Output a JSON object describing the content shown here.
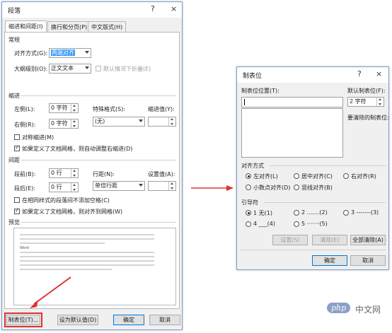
{
  "paragraph_dialog": {
    "title": "段落",
    "help_icon": "?",
    "close_icon": "×",
    "tabs": [
      {
        "label": "缩进和间距(I)",
        "active": true
      },
      {
        "label": "换行和分页(P)",
        "active": false
      },
      {
        "label": "中文版式(H)",
        "active": false
      }
    ],
    "general": {
      "section": "常规",
      "alignment_label": "对齐方式(G):",
      "alignment_value": "两端对齐",
      "outline_label": "大纲级别(O):",
      "outline_value": "正文文本",
      "collapse_label": "默认情况下折叠(E)"
    },
    "indent": {
      "section": "缩进",
      "left_label": "左侧(L):",
      "left_value": "0 字符",
      "right_label": "右侧(R):",
      "right_value": "0 字符",
      "special_label": "特殊格式(S):",
      "special_value": "(无)",
      "by_label": "缩进值(Y):",
      "mirror_label": "对称缩进(M)",
      "grid_label": "如果定义了文档网格，则自动调整右缩进(D)"
    },
    "spacing": {
      "section": "间距",
      "before_label": "段前(B):",
      "before_value": "0 行",
      "after_label": "段后(E):",
      "after_value": "0 行",
      "line_label": "行距(N):",
      "line_value": "单倍行距",
      "at_label": "设置值(A):",
      "no_space_label": "在相同样式的段落间不添加空格(C)",
      "snap_label": "如果定义了文档网格，则对齐到网格(W)"
    },
    "preview": {
      "section": "预览",
      "sample_before": "前一段落前一段落前一段落前一段落前一段落前一段落前一段落前一段落前一段落前一段落前一段落",
      "sample_word": "Word",
      "sample_after": "下一段落下一段落下一段落下一段落下一段落下一段落下一段落下一段落下一段落下一段落"
    },
    "buttons": {
      "tabs": "制表位(T)...",
      "set_default": "设为默认值(D)",
      "ok": "确定",
      "cancel": "取消"
    }
  },
  "tabs_dialog": {
    "title": "制表位",
    "help_icon": "?",
    "close_icon": "×",
    "position_label": "制表位位置(T):",
    "default_label": "默认制表位(F):",
    "default_value": "2 字符",
    "clear_label": "要清除的制表位:",
    "alignment": {
      "section": "对齐方式",
      "options": [
        {
          "label": "左对齐(L)",
          "checked": true
        },
        {
          "label": "居中对齐(C)",
          "checked": false
        },
        {
          "label": "右对齐(R)",
          "checked": false
        },
        {
          "label": "小数点对齐(D)",
          "checked": false
        },
        {
          "label": "竖线对齐(B)",
          "checked": false
        }
      ]
    },
    "leader": {
      "section": "引导符",
      "options": [
        {
          "label": "1 无(1)",
          "checked": true
        },
        {
          "label": "2 .......(2)",
          "checked": false
        },
        {
          "label": "3 -------(3)",
          "checked": false
        },
        {
          "label": "4 ___(4)",
          "checked": false
        },
        {
          "label": "5 ·······(5)",
          "checked": false
        }
      ]
    },
    "buttons": {
      "set": "设置(S)",
      "clear": "清除(E)",
      "clear_all": "全部清除(A)",
      "ok": "确定",
      "cancel": "取消"
    }
  },
  "watermark": {
    "logo": "php",
    "text": "中文网"
  },
  "colors": {
    "annotation_red": "#e03030",
    "accent_blue": "#0078d7",
    "selection": "#3399ff"
  }
}
